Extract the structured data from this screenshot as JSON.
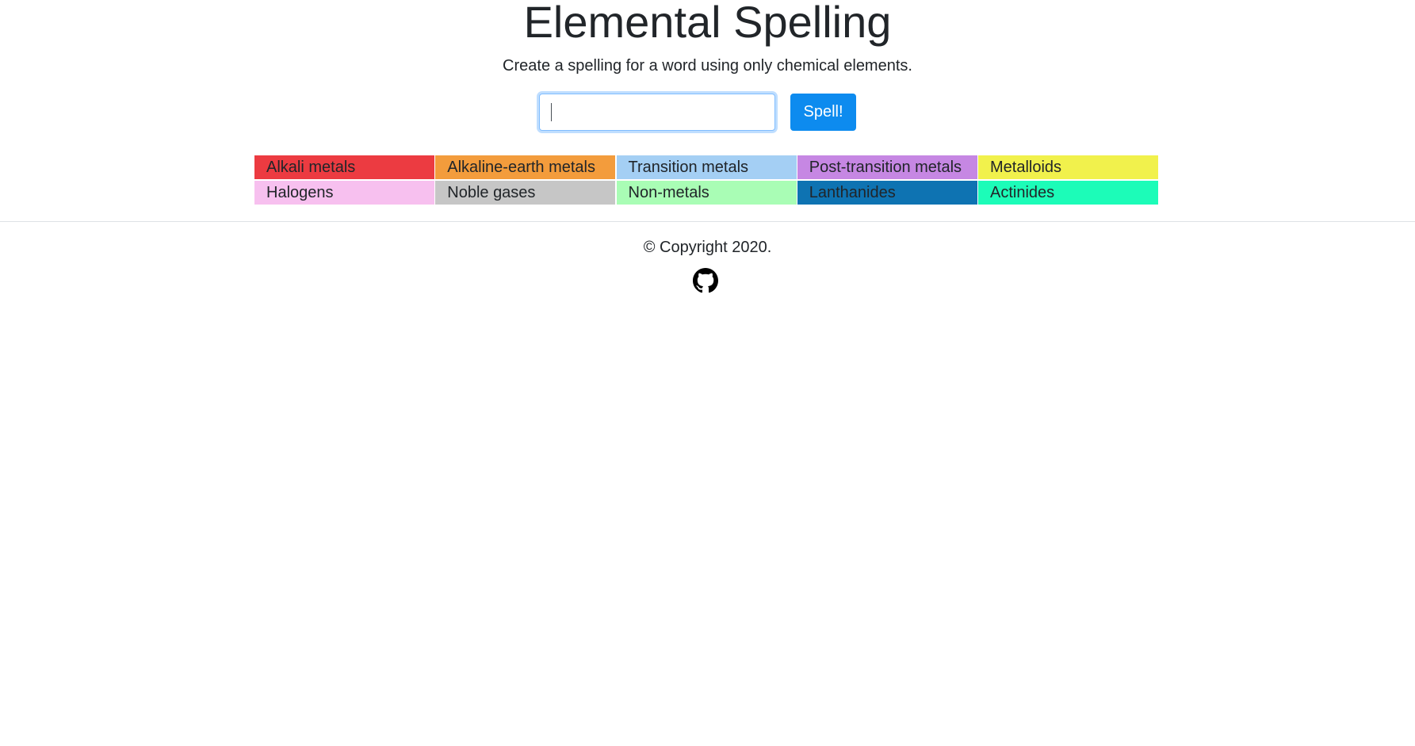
{
  "header": {
    "title": "Elemental Spelling",
    "subtitle": "Create a spelling for a word using only chemical elements."
  },
  "form": {
    "input_value": "",
    "input_placeholder": "",
    "button_label": "Spell!",
    "button_color": "#0d8bef"
  },
  "legend": {
    "items": [
      {
        "label": "Alkali metals",
        "color": "#ec3b41"
      },
      {
        "label": "Alkaline-earth metals",
        "color": "#f39c3c"
      },
      {
        "label": "Transition metals",
        "color": "#a4cff4"
      },
      {
        "label": "Post-transition metals",
        "color": "#c687e3"
      },
      {
        "label": "Metalloids",
        "color": "#f1f14c"
      },
      {
        "label": "Halogens",
        "color": "#f7c0ef"
      },
      {
        "label": "Noble gases",
        "color": "#c6c6c6"
      },
      {
        "label": "Non-metals",
        "color": "#a9fdb5"
      },
      {
        "label": "Lanthanides",
        "color": "#0e73b2"
      },
      {
        "label": "Actinides",
        "color": "#1cfcb8"
      }
    ]
  },
  "footer": {
    "copyright": "© Copyright 2020.",
    "icon": "github-icon"
  }
}
